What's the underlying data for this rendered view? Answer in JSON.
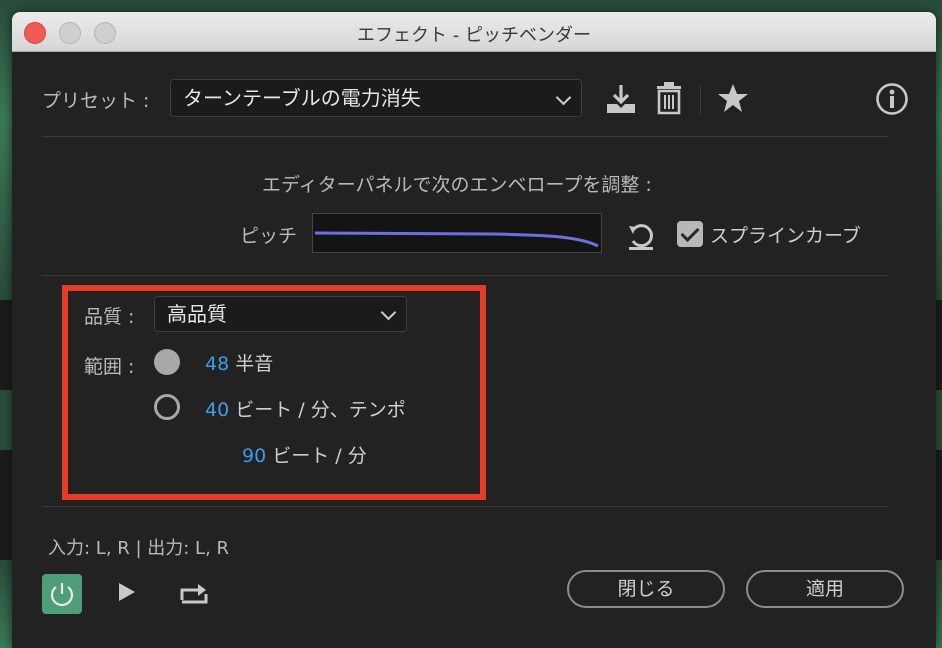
{
  "window": {
    "title": "エフェクト - ピッチベンダー"
  },
  "preset": {
    "label": "プリセット :",
    "value": "ターンテーブルの電力消失"
  },
  "toolbar_icons": [
    "download-icon",
    "trash-icon",
    "star-icon",
    "info-icon"
  ],
  "editor": {
    "instruction": "エディターパネルで次のエンベロープを調整 :",
    "envelope_label": "ピッチ",
    "spline_label": "スプラインカーブ",
    "spline_checked": true
  },
  "quality": {
    "label": "品質 :",
    "value": "高品質"
  },
  "range": {
    "label": "範囲 :",
    "options": [
      {
        "value": "48",
        "unit": "半音",
        "selected": true
      },
      {
        "value": "40",
        "unit": "ビート / 分、テンポ",
        "selected": false
      }
    ],
    "tempo": {
      "value": "90",
      "unit": "ビート / 分"
    }
  },
  "io": {
    "text": "入力: L, R | 出力: L, R"
  },
  "buttons": {
    "close": "閉じる",
    "apply": "適用"
  },
  "colors": {
    "accent_blue": "#3d9be9",
    "highlight_red": "#e63b26",
    "power_green": "#4f9e7a",
    "envelope_line": "#6f6fe0"
  }
}
